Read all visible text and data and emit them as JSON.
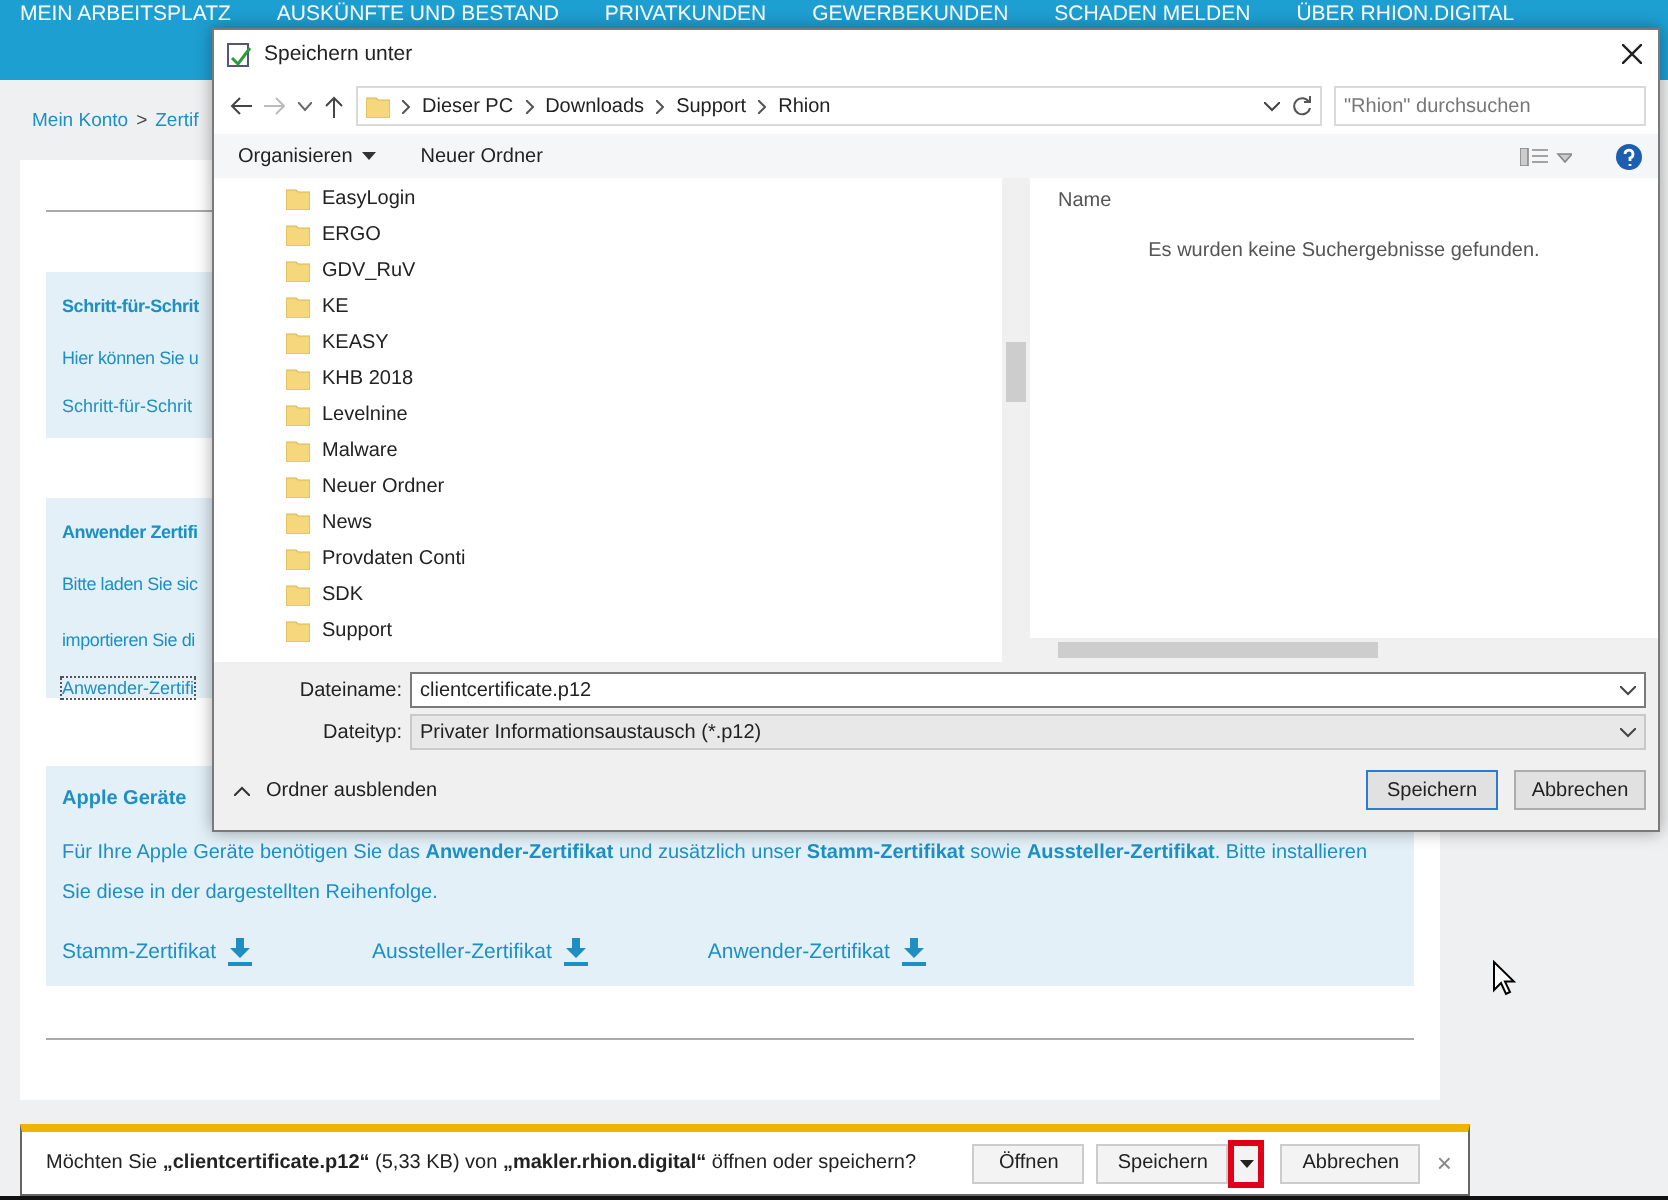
{
  "nav": {
    "items": [
      "MEIN ARBEITSPLATZ",
      "AUSKÜNFTE UND BESTAND",
      "PRIVATKUNDEN",
      "GEWERBEKUNDEN",
      "SCHADEN MELDEN",
      "ÜBER RHION.DIGITAL"
    ]
  },
  "breadcrumb": [
    "Mein Konto",
    ">",
    "Zertif"
  ],
  "sections": [
    {
      "title": "Schritt-für-Schrit",
      "lines": [
        "Hier können Sie u"
      ],
      "links": [
        "Schritt-für-Schrit"
      ]
    },
    {
      "title": "Anwender Zertifi",
      "lines": [
        "Bitte laden Sie sic",
        "importieren Sie di"
      ],
      "links": [
        "Anwender-Zertifi"
      ]
    }
  ],
  "apple": {
    "title": "Apple Geräte",
    "text": "Für Ihre Apple Geräte benötigen Sie das **Anwender-Zertifikat** und zusätzlich unser **Stamm-Zertifikat** sowie **Aussteller-Zertifikat**. Bitte installieren Sie diese in der dargestellten Reihenfolge.",
    "downloads": [
      "Stamm-Zertifikat",
      "Aussteller-Zertifikat",
      "Anwender-Zertifikat"
    ]
  },
  "dialog": {
    "title": "Speichern unter",
    "path": [
      "Dieser PC",
      "Downloads",
      "Support",
      "Rhion"
    ],
    "search": {
      "placeholder": "\"Rhion\" durchsuchen"
    },
    "toolbar": [
      "Organisieren",
      "Neuer Ordner"
    ],
    "folders": [
      "EasyLogin",
      "ERGO",
      "GDV_RuV",
      "KE",
      "KEASY",
      "KHB 2018",
      "Levelnine",
      "Malware",
      "Neuer Ordner",
      "News",
      "Provdaten Conti",
      "SDK",
      "Support"
    ],
    "column": "Name",
    "empty_message": "Es wurden keine Suchergebnisse gefunden.",
    "filename": {
      "label": "Dateiname:",
      "value": "clientcertificate.p12"
    },
    "filetype": {
      "label": "Dateityp:",
      "value": "Privater Informationsaustausch (*.p12)"
    },
    "hide_folders": "Ordner ausblenden",
    "buttons": [
      "Speichern",
      "Abbrechen"
    ]
  },
  "download_bar": {
    "message": "Möchten Sie **„clientcertificate.p12“** (5,33 KB) von **„makler.rhion.digital“** öffnen oder speichern?",
    "open": "Öffnen",
    "save": "Speichern",
    "dropdown_highlighted": true,
    "cancel": "Abbrechen",
    "close": "×"
  }
}
